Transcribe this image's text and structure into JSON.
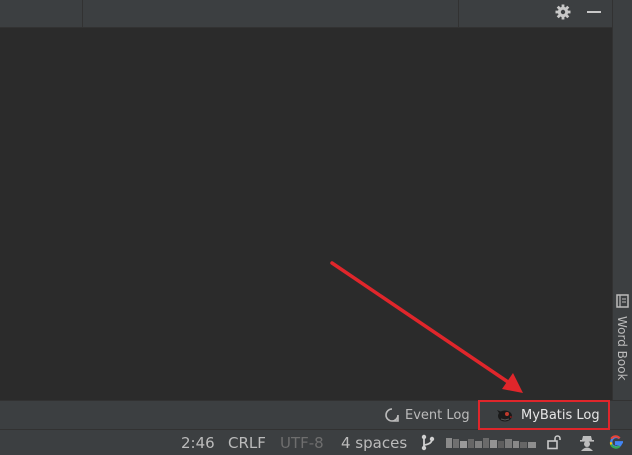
{
  "right_stripe": {
    "word_book_label": "Word Book"
  },
  "tool_window_bar": {
    "event_log_label": "Event Log",
    "mybatis_log_label": "MyBatis Log"
  },
  "status_bar": {
    "caret_position": "2:46",
    "line_separator": "CRLF",
    "encoding": "UTF-8",
    "indent": "4 spaces"
  },
  "icons": {
    "top_right": [
      "gear-icon",
      "minimize-icon"
    ],
    "status_bar": [
      "git-branch-icon",
      "lock-icon",
      "inspector-icon",
      "google-icon"
    ]
  },
  "colors": {
    "editor_bg": "#2b2b2b",
    "panel_bg": "#3c3f41",
    "highlight_red": "#e0262b",
    "text": "#bbbbbb"
  }
}
